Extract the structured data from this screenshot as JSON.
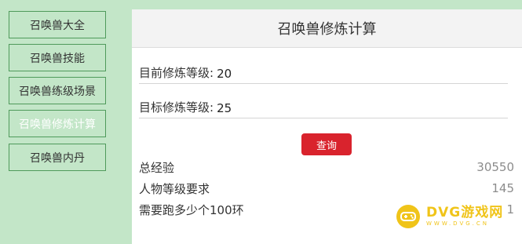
{
  "sidebar": {
    "items": [
      {
        "label": "召唤兽大全",
        "active": false
      },
      {
        "label": "召唤兽技能",
        "active": false
      },
      {
        "label": "召唤兽练级场景",
        "active": false
      },
      {
        "label": "召唤兽修炼计算",
        "active": true
      },
      {
        "label": "召唤兽内丹",
        "active": false
      }
    ]
  },
  "panel": {
    "title": "召唤兽修炼计算",
    "current_level": {
      "label": "目前修炼等级:",
      "value": "20"
    },
    "target_level": {
      "label": "目标修炼等级:",
      "value": "25"
    },
    "query_label": "查询",
    "results": [
      {
        "label": "总经验",
        "value": "30550"
      },
      {
        "label": "人物等级要求",
        "value": "145"
      },
      {
        "label": "需要跑多少个100环",
        "value": "1"
      }
    ]
  },
  "watermark": {
    "icon": "gamepad-icon",
    "text": "DVG游戏网",
    "sub": "WWW.DVG.CN"
  },
  "colors": {
    "background": "#c3e6c8",
    "nav_border": "#4f9a5b",
    "query_button": "#d9232d",
    "watermark": "#f0c419"
  }
}
